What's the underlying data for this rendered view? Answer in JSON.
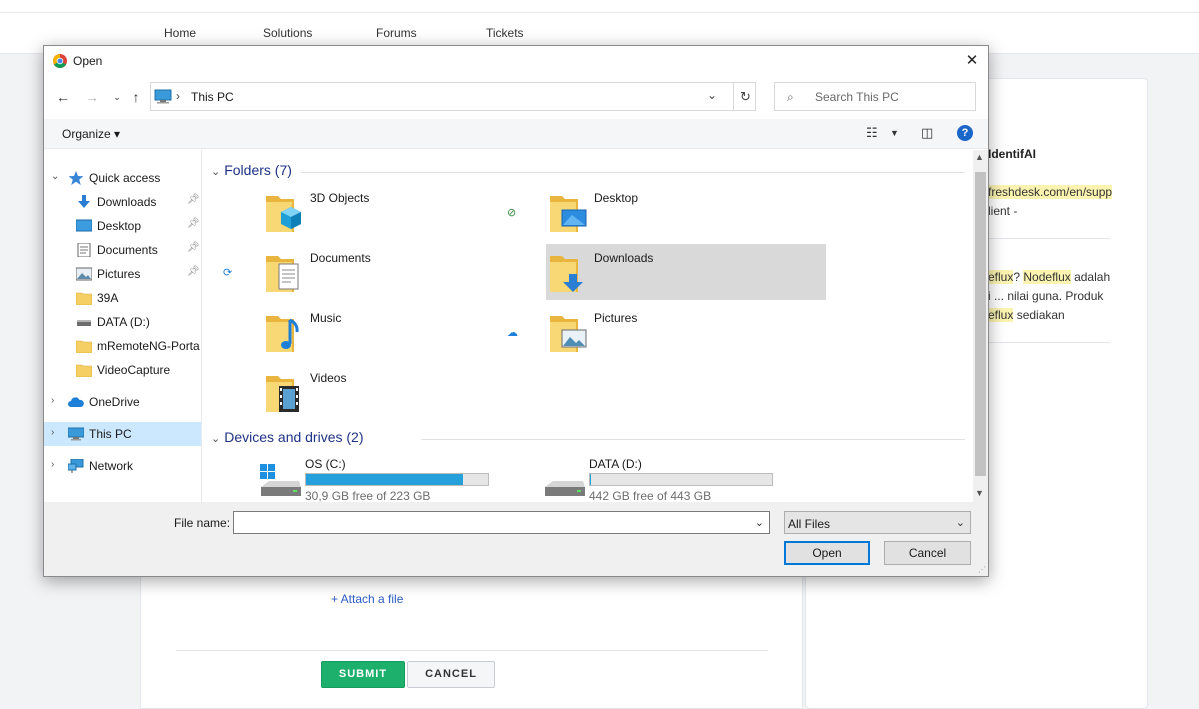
{
  "web": {
    "nav": [
      "Home",
      "Solutions",
      "Forums",
      "Tickets"
    ],
    "attach_label": "+ Attach a file",
    "submit_label": "SUBMIT",
    "cancel_label": "CANCEL",
    "side": {
      "title_fragment": "IdentifAI",
      "link_fragment": "freshdesk.com/en/supp",
      "client_fragment": "lient -",
      "line1_a": "eflux",
      "line1_b": "? ",
      "line1_c": "Nodeflux",
      "line1_d": " adalah",
      "line2": "i ... nilai guna. Produk",
      "line3_a": "eflux",
      "line3_b": " sediakan"
    }
  },
  "dialog": {
    "title": "Open",
    "close_glyph": "✕",
    "address": {
      "location": "This PC"
    },
    "search": {
      "placeholder": "Search This PC"
    },
    "toolbar": {
      "organize_label": "Organize ▾",
      "help_glyph": "?"
    },
    "tree": [
      {
        "label": "Quick access",
        "pinned": false
      },
      {
        "label": "Downloads",
        "pinned": true
      },
      {
        "label": "Desktop",
        "pinned": true
      },
      {
        "label": "Documents",
        "pinned": true
      },
      {
        "label": "Pictures",
        "pinned": true
      },
      {
        "label": "39A",
        "pinned": false
      },
      {
        "label": "DATA (D:)",
        "pinned": false
      },
      {
        "label": "mRemoteNG-Porta",
        "pinned": false
      },
      {
        "label": "VideoCapture",
        "pinned": false
      },
      {
        "label": "OneDrive",
        "pinned": false
      },
      {
        "label": "This PC",
        "pinned": false,
        "selected": true
      },
      {
        "label": "Network",
        "pinned": false
      }
    ],
    "groups": {
      "folders_label": "Folders (7)",
      "devices_label": "Devices and drives (2)"
    },
    "folders": [
      {
        "name": "3D Objects"
      },
      {
        "name": "Desktop",
        "status": "synced"
      },
      {
        "name": "Documents",
        "status": "syncing"
      },
      {
        "name": "Downloads",
        "selected": true
      },
      {
        "name": "Music"
      },
      {
        "name": "Pictures",
        "status": "cloud"
      },
      {
        "name": "Videos"
      }
    ],
    "drives": [
      {
        "name": "OS (C:)",
        "free_text": "30,9 GB free of 223 GB",
        "used_fraction": 0.861
      },
      {
        "name": "DATA (D:)",
        "free_text": "442 GB free of 443 GB",
        "used_fraction": 0.002
      }
    ],
    "footer": {
      "filename_label": "File name:",
      "filename_value": "",
      "filetype": "All Files",
      "open_label": "Open",
      "cancel_label": "Cancel"
    }
  },
  "colors": {
    "accent": "#0078d7",
    "selection": "#cce8ff",
    "drive_bar": "#26a0da",
    "submit_green": "#1db06d"
  }
}
